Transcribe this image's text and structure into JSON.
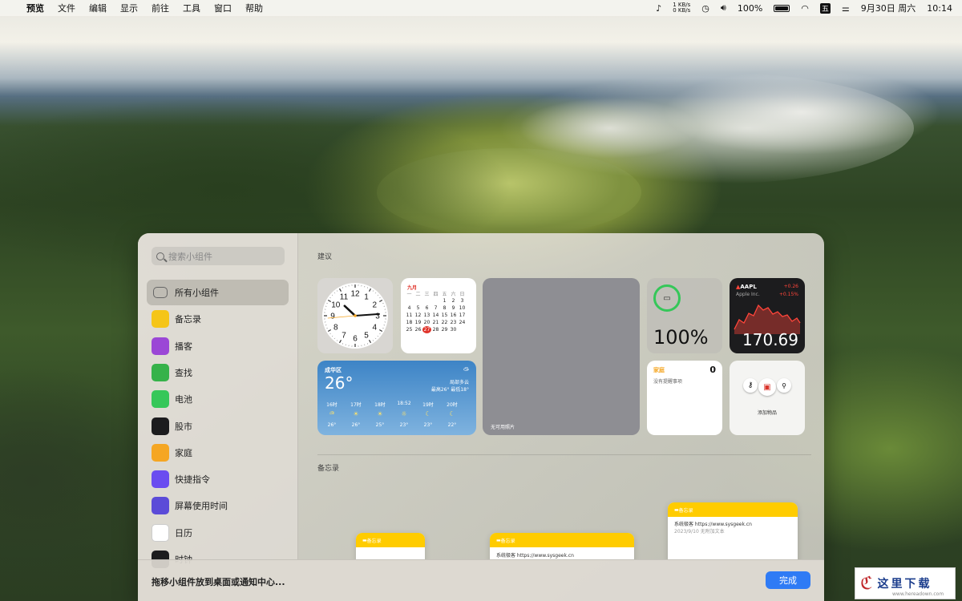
{
  "menubar": {
    "items": [
      "预览",
      "文件",
      "编辑",
      "显示",
      "前往",
      "工具",
      "窗口",
      "帮助"
    ],
    "net_up": "1 KB/s",
    "net_down": "0 KB/s",
    "battery": "100%",
    "date": "9月30日 周六",
    "time": "10:14"
  },
  "sidebar": {
    "search_placeholder": "搜索小组件",
    "items": [
      {
        "label": "所有小组件",
        "icon": "widgets-icon",
        "color": "#888888"
      },
      {
        "label": "备忘录",
        "icon": "notes-icon",
        "color": "#f5c518"
      },
      {
        "label": "播客",
        "icon": "podcasts-icon",
        "color": "#9b47d6"
      },
      {
        "label": "查找",
        "icon": "find-my-icon",
        "color": "#36b24a"
      },
      {
        "label": "电池",
        "icon": "battery-icon",
        "color": "#35c759"
      },
      {
        "label": "股市",
        "icon": "stocks-icon",
        "color": "#1c1c1e"
      },
      {
        "label": "家庭",
        "icon": "home-icon",
        "color": "#f5a623"
      },
      {
        "label": "快捷指令",
        "icon": "shortcuts-icon",
        "color": "#6a4cf0"
      },
      {
        "label": "屏幕使用时间",
        "icon": "screen-time-icon",
        "color": "#5b4bd8"
      },
      {
        "label": "日历",
        "icon": "calendar-icon",
        "color": "#ffffff"
      },
      {
        "label": "时钟",
        "icon": "clock-icon",
        "color": "#1c1c1e"
      }
    ]
  },
  "content": {
    "suggest_title": "建议",
    "notes_title": "备忘录",
    "calendar": {
      "month": "九月",
      "week": [
        "一",
        "二",
        "三",
        "四",
        "五",
        "六",
        "日"
      ],
      "rows": [
        [
          "",
          "",
          "",
          "",
          "1",
          "2",
          "3"
        ],
        [
          "4",
          "5",
          "6",
          "7",
          "8",
          "9",
          "10"
        ],
        [
          "11",
          "12",
          "13",
          "14",
          "15",
          "16",
          "17"
        ],
        [
          "18",
          "19",
          "20",
          "21",
          "22",
          "23",
          "24"
        ],
        [
          "25",
          "26",
          "27",
          "28",
          "29",
          "30",
          ""
        ]
      ],
      "today": "27"
    },
    "clock": {
      "nums": [
        "12",
        "1",
        "2",
        "3",
        "4",
        "5",
        "6",
        "7",
        "8",
        "9",
        "10",
        "11"
      ]
    },
    "weather": {
      "city": "成华区",
      "temp": "26°",
      "cond": "局部多云",
      "range": "最高26° 最低18°",
      "hours": [
        {
          "t": "16时",
          "v": "26°"
        },
        {
          "t": "17时",
          "v": "26°"
        },
        {
          "t": "18时",
          "v": "25°"
        },
        {
          "t": "18:52",
          "v": "23°"
        },
        {
          "t": "19时",
          "v": "23°"
        },
        {
          "t": "20时",
          "v": "22°"
        }
      ]
    },
    "photos": {
      "label": "无可用照片"
    },
    "battery": {
      "value": "100%"
    },
    "stock": {
      "symbol": "AAPL",
      "name": "Apple Inc.",
      "change": "+0.26",
      "pct": "+0.15%",
      "price": "170.69"
    },
    "home": {
      "title": "家庭",
      "count": "0",
      "text": "没有提醒事项"
    },
    "findmy": {
      "label": "添加物品"
    },
    "notes": [
      {
        "header": "备忘录",
        "line1": "系统极客 https://www.sysgeek.cn",
        "line2": "2023/9/10   无附加文本"
      },
      {
        "header": "备忘录",
        "line1": "系统极客 https://www.sysgeek.cn"
      },
      {
        "header": "备忘录"
      }
    ]
  },
  "bottom": {
    "hint": "拖移小组件放到桌面或通知中心...",
    "done": "完成"
  },
  "watermark": {
    "text": "这里下载",
    "site": "www.hereadown.com"
  }
}
